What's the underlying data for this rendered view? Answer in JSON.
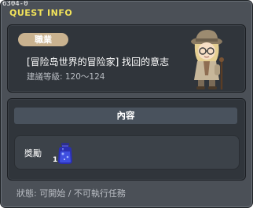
{
  "window": {
    "id_label": "6304-0",
    "title": "QUEST INFO"
  },
  "quest": {
    "job_badge": "職業",
    "name": "[冒险岛世界的冒险家] 找回的意志",
    "level": "建議等級: 120～124",
    "npc_icon": "explorer-npc-portrait-icon"
  },
  "content": {
    "header": "內容",
    "reward_label": "獎勵",
    "reward_item": {
      "icon": "blue-potion-icon",
      "quantity": "1"
    }
  },
  "status": {
    "text": "狀態:  可開始 / 不可執行任務"
  },
  "colors": {
    "title": "#f2e35a",
    "badge": "#c9b28f",
    "window_bg": "#4b5057",
    "panel_bg": "#30353b",
    "header_bg": "#49525d"
  }
}
